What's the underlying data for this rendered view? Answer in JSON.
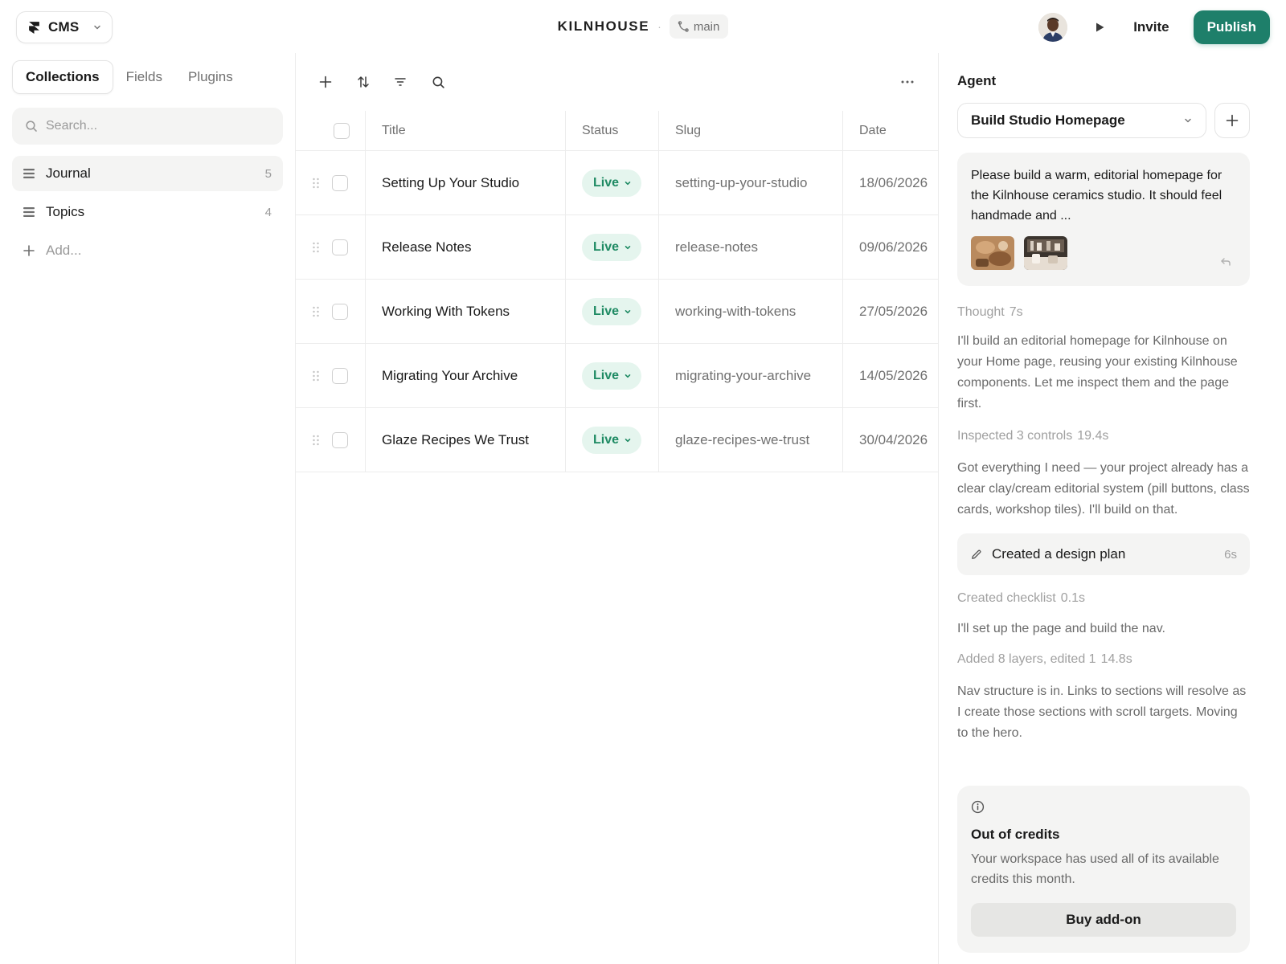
{
  "header": {
    "app_switcher_label": "CMS",
    "project_name": "KILNHOUSE",
    "separator": "·",
    "branch": "main",
    "invite_label": "Invite",
    "publish_label": "Publish",
    "accent_color": "#1e7f6a"
  },
  "sidebar": {
    "tabs": [
      {
        "label": "Collections",
        "active": true
      },
      {
        "label": "Fields",
        "active": false
      },
      {
        "label": "Plugins",
        "active": false
      }
    ],
    "search_placeholder": "Search...",
    "collections": [
      {
        "name": "Journal",
        "count": "5",
        "active": true
      },
      {
        "name": "Topics",
        "count": "4",
        "active": false
      }
    ],
    "add_label": "Add..."
  },
  "toolbar": {
    "icons": [
      "plus-icon",
      "sort-icon",
      "filter-icon",
      "search-icon",
      "more-icon"
    ]
  },
  "table": {
    "columns": {
      "title": "Title",
      "status": "Status",
      "slug": "Slug",
      "date": "Date"
    },
    "rows": [
      {
        "title": "Setting Up Your Studio",
        "status": "Live",
        "slug": "setting-up-your-studio",
        "date": "18/06/2026"
      },
      {
        "title": "Release Notes",
        "status": "Live",
        "slug": "release-notes",
        "date": "09/06/2026"
      },
      {
        "title": "Working With Tokens",
        "status": "Live",
        "slug": "working-with-tokens",
        "date": "27/05/2026"
      },
      {
        "title": "Migrating Your Archive",
        "status": "Live",
        "slug": "migrating-your-archive",
        "date": "14/05/2026"
      },
      {
        "title": "Glaze Recipes We Trust",
        "status": "Live",
        "slug": "glaze-recipes-we-trust",
        "date": "30/04/2026"
      }
    ],
    "status_color": "#1e8a63"
  },
  "agent": {
    "title": "Agent",
    "session": "Build Studio Homepage",
    "prompt": "Please build a warm, editorial homepage for the Kilnhouse ceramics studio. It should feel handmade and ...",
    "feed": {
      "thought_label": "Thought",
      "thought_duration": "7s",
      "thought_text": "I'll build an editorial homepage for Kilnhouse on your Home page, reusing your existing Kilnhouse components. Let me inspect them and the page first.",
      "inspected_label": "Inspected 3 controls",
      "inspected_duration": "19.4s",
      "got_text": "Got everything I need — your project already has a clear clay/cream editorial system (pill buttons, class cards, workshop tiles). I'll build on that.",
      "plan_label": "Created a design plan",
      "plan_duration": "6s",
      "checklist_label": "Created checklist",
      "checklist_duration": "0.1s",
      "setup_text": "I'll set up the page and build the nav.",
      "layers_label": "Added 8 layers, edited 1",
      "layers_duration": "14.8s",
      "nav_text": "Nav structure is in. Links to sections will resolve as I create those sections with scroll targets. Moving to the hero."
    },
    "credits": {
      "title": "Out of credits",
      "description": "Your workspace has used all of its available credits this month.",
      "button": "Buy add-on"
    }
  }
}
